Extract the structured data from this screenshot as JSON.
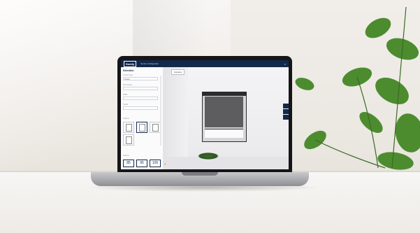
{
  "app": {
    "logo": "Somfy",
    "title": "Somfy Configurator",
    "close_glyph": "×"
  },
  "sidebar": {
    "heading": "Selection",
    "fields": [
      {
        "label": "Product type",
        "value": "Screen"
      },
      {
        "label": "Dimensions",
        "value": ""
      },
      {
        "label": "Width",
        "value": ""
      },
      {
        "label": "Height",
        "value": ""
      }
    ],
    "section_label": "Options",
    "sizes": [
      "85",
      "95",
      "105"
    ]
  },
  "viewport": {
    "chip_label": "Camera"
  },
  "colors": {
    "header": "#13294b",
    "screen_fabric": "#5d5d60",
    "frame": "#2c2c2e"
  }
}
